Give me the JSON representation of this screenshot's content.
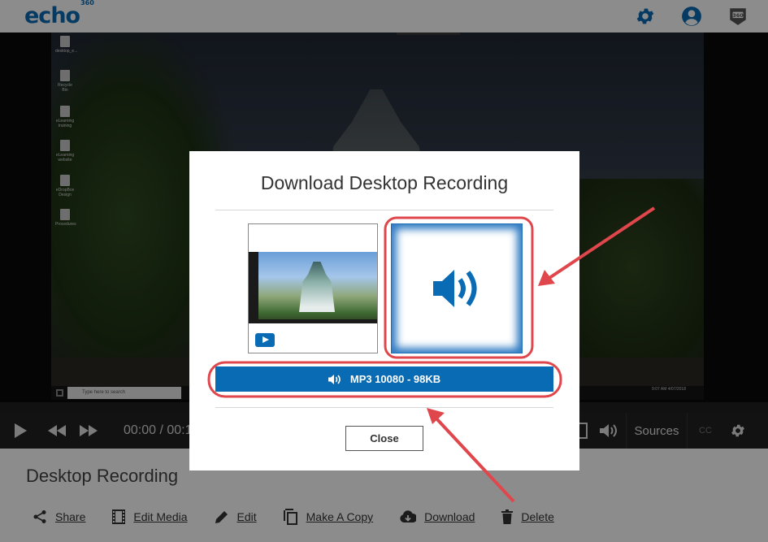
{
  "header": {
    "logo_text": "echo",
    "logo_superscript": "360",
    "icons": [
      "gear-icon",
      "user-icon",
      "echo360-badge-icon"
    ]
  },
  "player": {
    "time_display": "00:00 / 00:1",
    "sources_label": "Sources",
    "cc_label": "CC",
    "desktop_icons": [
      "desktop_e...",
      "Recycle Bin",
      "eLearning training",
      "eLearning website",
      "eDropBox Design",
      "Procedures"
    ],
    "taskbar_search": "Type here to search",
    "taskbar_clock": "9:07 AM 4/07/2018"
  },
  "recording": {
    "title": "Desktop Recording"
  },
  "actions": [
    {
      "label": "Share",
      "icon": "share-icon"
    },
    {
      "label": "Edit Media",
      "icon": "film-icon"
    },
    {
      "label": "Edit",
      "icon": "pencil-icon"
    },
    {
      "label": "Make A Copy",
      "icon": "copy-icon"
    },
    {
      "label": "Download",
      "icon": "cloud-download-icon"
    },
    {
      "label": "Delete",
      "icon": "trash-icon"
    }
  ],
  "modal": {
    "title": "Download Desktop Recording",
    "download_option_label": "MP3 10080 - 98KB",
    "close_label": "Close"
  },
  "colors": {
    "brand_blue": "#0a6bb5",
    "annotation_red": "#e0474c"
  }
}
